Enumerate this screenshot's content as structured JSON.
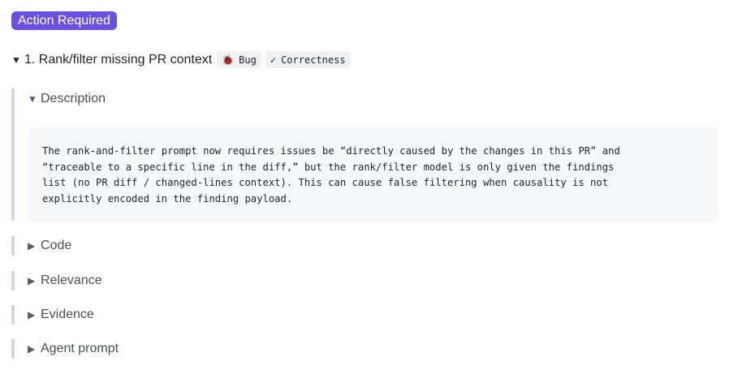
{
  "badge": {
    "label": "Action Required",
    "color": "#6b4fe0"
  },
  "issue": {
    "caret": "▼",
    "title": "1. Rank/filter missing PR context",
    "tags": [
      {
        "icon": "bug-icon",
        "glyph": "🐞",
        "label": "Bug"
      },
      {
        "icon": "check-icon",
        "glyph": "✓",
        "label": "Correctness"
      }
    ]
  },
  "sections": {
    "description": {
      "caret": "▼",
      "label": "Description",
      "lines": [
        "The rank-and-filter prompt now requires issues be “directly caused by the changes in this PR” and",
        "“traceable to a specific line in the diff,” but the rank/filter model is only given the findings",
        "list (no PR diff / changed-lines context). This can cause false filtering when causality is not",
        "explicitly encoded in the finding payload."
      ]
    },
    "code": {
      "caret": "▶",
      "label": "Code"
    },
    "relevance": {
      "caret": "▶",
      "label": "Relevance"
    },
    "evidence": {
      "caret": "▶",
      "label": "Evidence"
    },
    "agent_prompt": {
      "caret": "▶",
      "label": "Agent prompt"
    }
  }
}
